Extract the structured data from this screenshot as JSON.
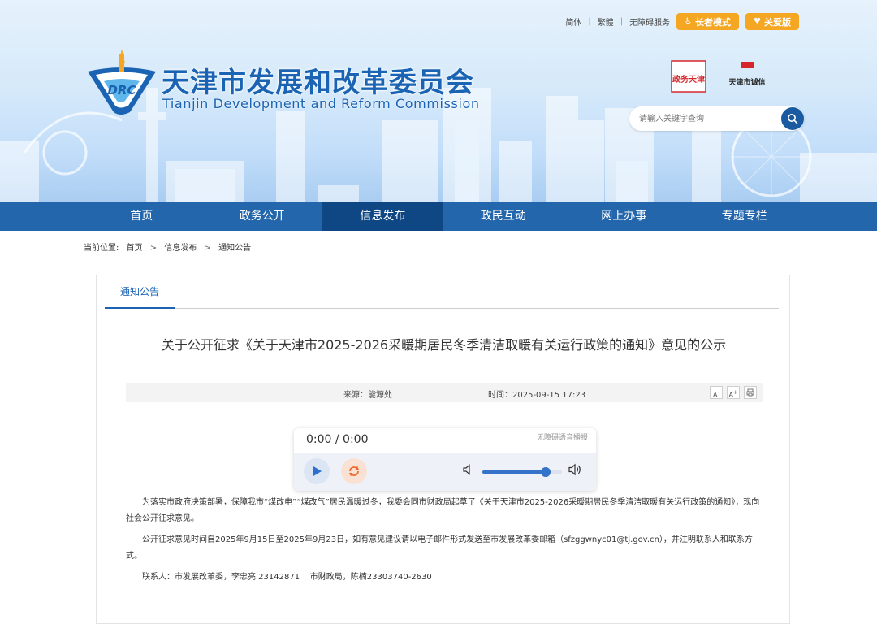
{
  "topbar": {
    "simplified": "简体",
    "traditional": "繁體",
    "accessibility": "无障碍服务",
    "elder_mode": "长者模式",
    "care_version": "关爱版"
  },
  "header": {
    "logo_text": "DRC",
    "title_cn": "天津市发展和改革委员会",
    "title_en": "Tianjin Development and Reform Commission",
    "seal1": "政务天津",
    "seal2": "天津市诚信",
    "search_placeholder": "请输入关键字查询"
  },
  "nav": {
    "items": [
      {
        "label": "首页"
      },
      {
        "label": "政务公开"
      },
      {
        "label": "信息发布"
      },
      {
        "label": "政民互动"
      },
      {
        "label": "网上办事"
      },
      {
        "label": "专题专栏"
      }
    ],
    "active_index": 2
  },
  "breadcrumb": {
    "prefix": "当前位置:",
    "items": [
      "首页",
      "信息发布",
      "通知公告"
    ]
  },
  "article": {
    "tab": "通知公告",
    "title": "关于公开征求《关于天津市2025-2026采暖期居民冬季清洁取暖有关运行政策的通知》意见的公示",
    "source": "来源：能源处",
    "time": "时间：2025-09-15 17:23",
    "tools": [
      "A-",
      "A+",
      "print"
    ],
    "paragraphs": [
      "为落实市政府决策部署，保障我市“煤改电”“煤改气”居民温暖过冬，我委会同市财政局起草了《关于天津市2025-2026采暖期居民冬季清洁取暖有关运行政策的通知》，现向社会公开征求意见。",
      "公开征求意见时间自2025年9月15日至2025年9月23日，如有意见建议请以电子邮件形式发送至市发展改革委邮箱（sfzggwnyc01@tj.gov.cn），并注明联系人和联系方式。",
      "联系人：市发展改革委，李忠亮 23142871    市财政局，陈楠23303740-2630"
    ]
  },
  "player": {
    "timecode": "0:00 / 0:00",
    "hint": "无障碍语音播报",
    "volume": 0.8
  },
  "colors": {
    "brand_blue": "#1b63b3",
    "nav_bg": "#2466ac",
    "nav_active": "#0f4684",
    "accent_orange": "#f5a623"
  }
}
